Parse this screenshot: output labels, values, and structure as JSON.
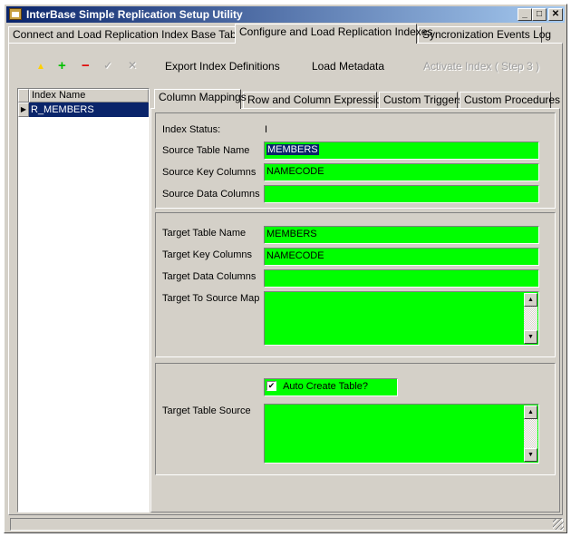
{
  "window": {
    "title": "InterBase Simple Replication Setup Utility",
    "minimize": "_",
    "maximize": "□",
    "close": "✕"
  },
  "main_tabs": [
    {
      "label": "Connect and Load Replication Index Base Table"
    },
    {
      "label": "Configure and Load Replication Indexes"
    },
    {
      "label": "Syncronization Events Log"
    }
  ],
  "toolbar": {
    "up_icon": "▲",
    "add_icon": "+",
    "remove_icon": "−",
    "check_icon": "✓",
    "cancel_icon": "✕",
    "export_label": "Export Index Definitions",
    "load_label": "Load Metadata",
    "activate_label": "Activate Index ( Step 3 )"
  },
  "index_grid": {
    "header": "Index Name",
    "row_indicator": "▶",
    "rows": [
      "R_MEMBERS"
    ]
  },
  "sub_tabs": [
    {
      "label": "Column Mappings"
    },
    {
      "label": "Row and Column Expressions"
    },
    {
      "label": "Custom Triggers"
    },
    {
      "label": "Custom Procedures"
    }
  ],
  "source": {
    "index_status_label": "Index Status:",
    "index_status_value": "I",
    "table_name_label": "Source Table Name",
    "table_name_value": "MEMBERS",
    "key_columns_label": "Source Key Columns",
    "key_columns_value": "NAMECODE",
    "data_columns_label": "Source Data Columns",
    "data_columns_value": ""
  },
  "target": {
    "table_name_label": "Target Table Name",
    "table_name_value": "MEMBERS",
    "key_columns_label": "Target Key Columns",
    "key_columns_value": "NAMECODE",
    "data_columns_label": "Target Data Columns",
    "data_columns_value": "",
    "map_label": "Target To Source Map",
    "map_value": ""
  },
  "create": {
    "auto_create_label": "Auto Create Table?",
    "auto_create_checked": true,
    "check_mark": "✔",
    "table_source_label": "Target Table Source",
    "table_source_value": ""
  },
  "scroll": {
    "up": "▲",
    "down": "▼"
  },
  "colors": {
    "field_green": "#00ff00",
    "title_blue": "#0a246a",
    "toolbar_up": "#ffd000",
    "toolbar_add": "#00c000",
    "toolbar_remove": "#e00000"
  }
}
